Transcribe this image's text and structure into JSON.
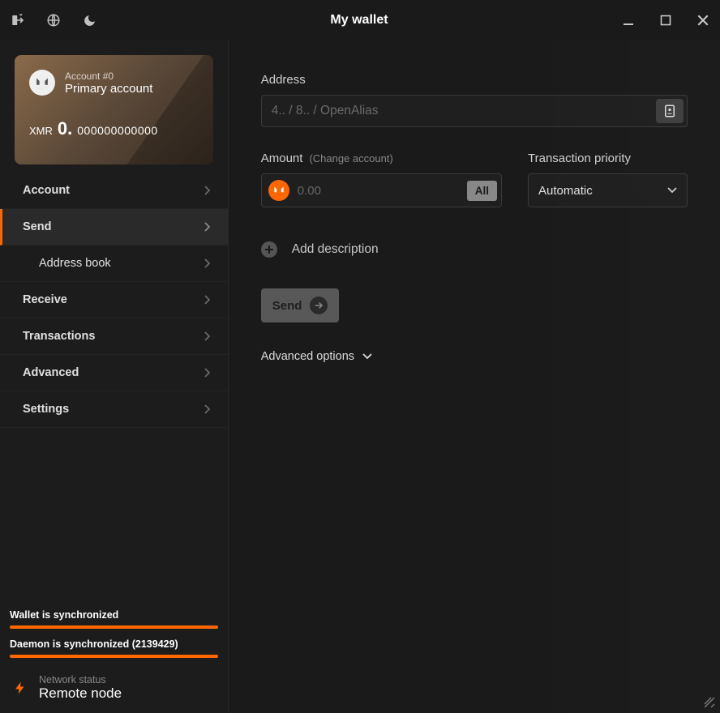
{
  "titlebar": {
    "title": "My wallet"
  },
  "account_card": {
    "account_number": "Account #0",
    "account_name": "Primary account",
    "currency": "XMR",
    "balance_whole": "0.",
    "balance_fraction": "000000000000"
  },
  "nav": {
    "account": "Account",
    "send": "Send",
    "address_book": "Address book",
    "receive": "Receive",
    "transactions": "Transactions",
    "advanced": "Advanced",
    "settings": "Settings"
  },
  "status": {
    "wallet_sync": "Wallet is synchronized",
    "daemon_sync": "Daemon is synchronized (2139429)",
    "network_status_label": "Network status",
    "network_status_value": "Remote node"
  },
  "send_form": {
    "address_label": "Address",
    "address_placeholder": "4.. / 8.. / OpenAlias",
    "amount_label": "Amount",
    "amount_hint": "(Change account)",
    "amount_placeholder": "0.00",
    "all_button": "All",
    "priority_label": "Transaction priority",
    "priority_value": "Automatic",
    "add_description": "Add description",
    "send_button": "Send",
    "advanced_options": "Advanced options"
  }
}
